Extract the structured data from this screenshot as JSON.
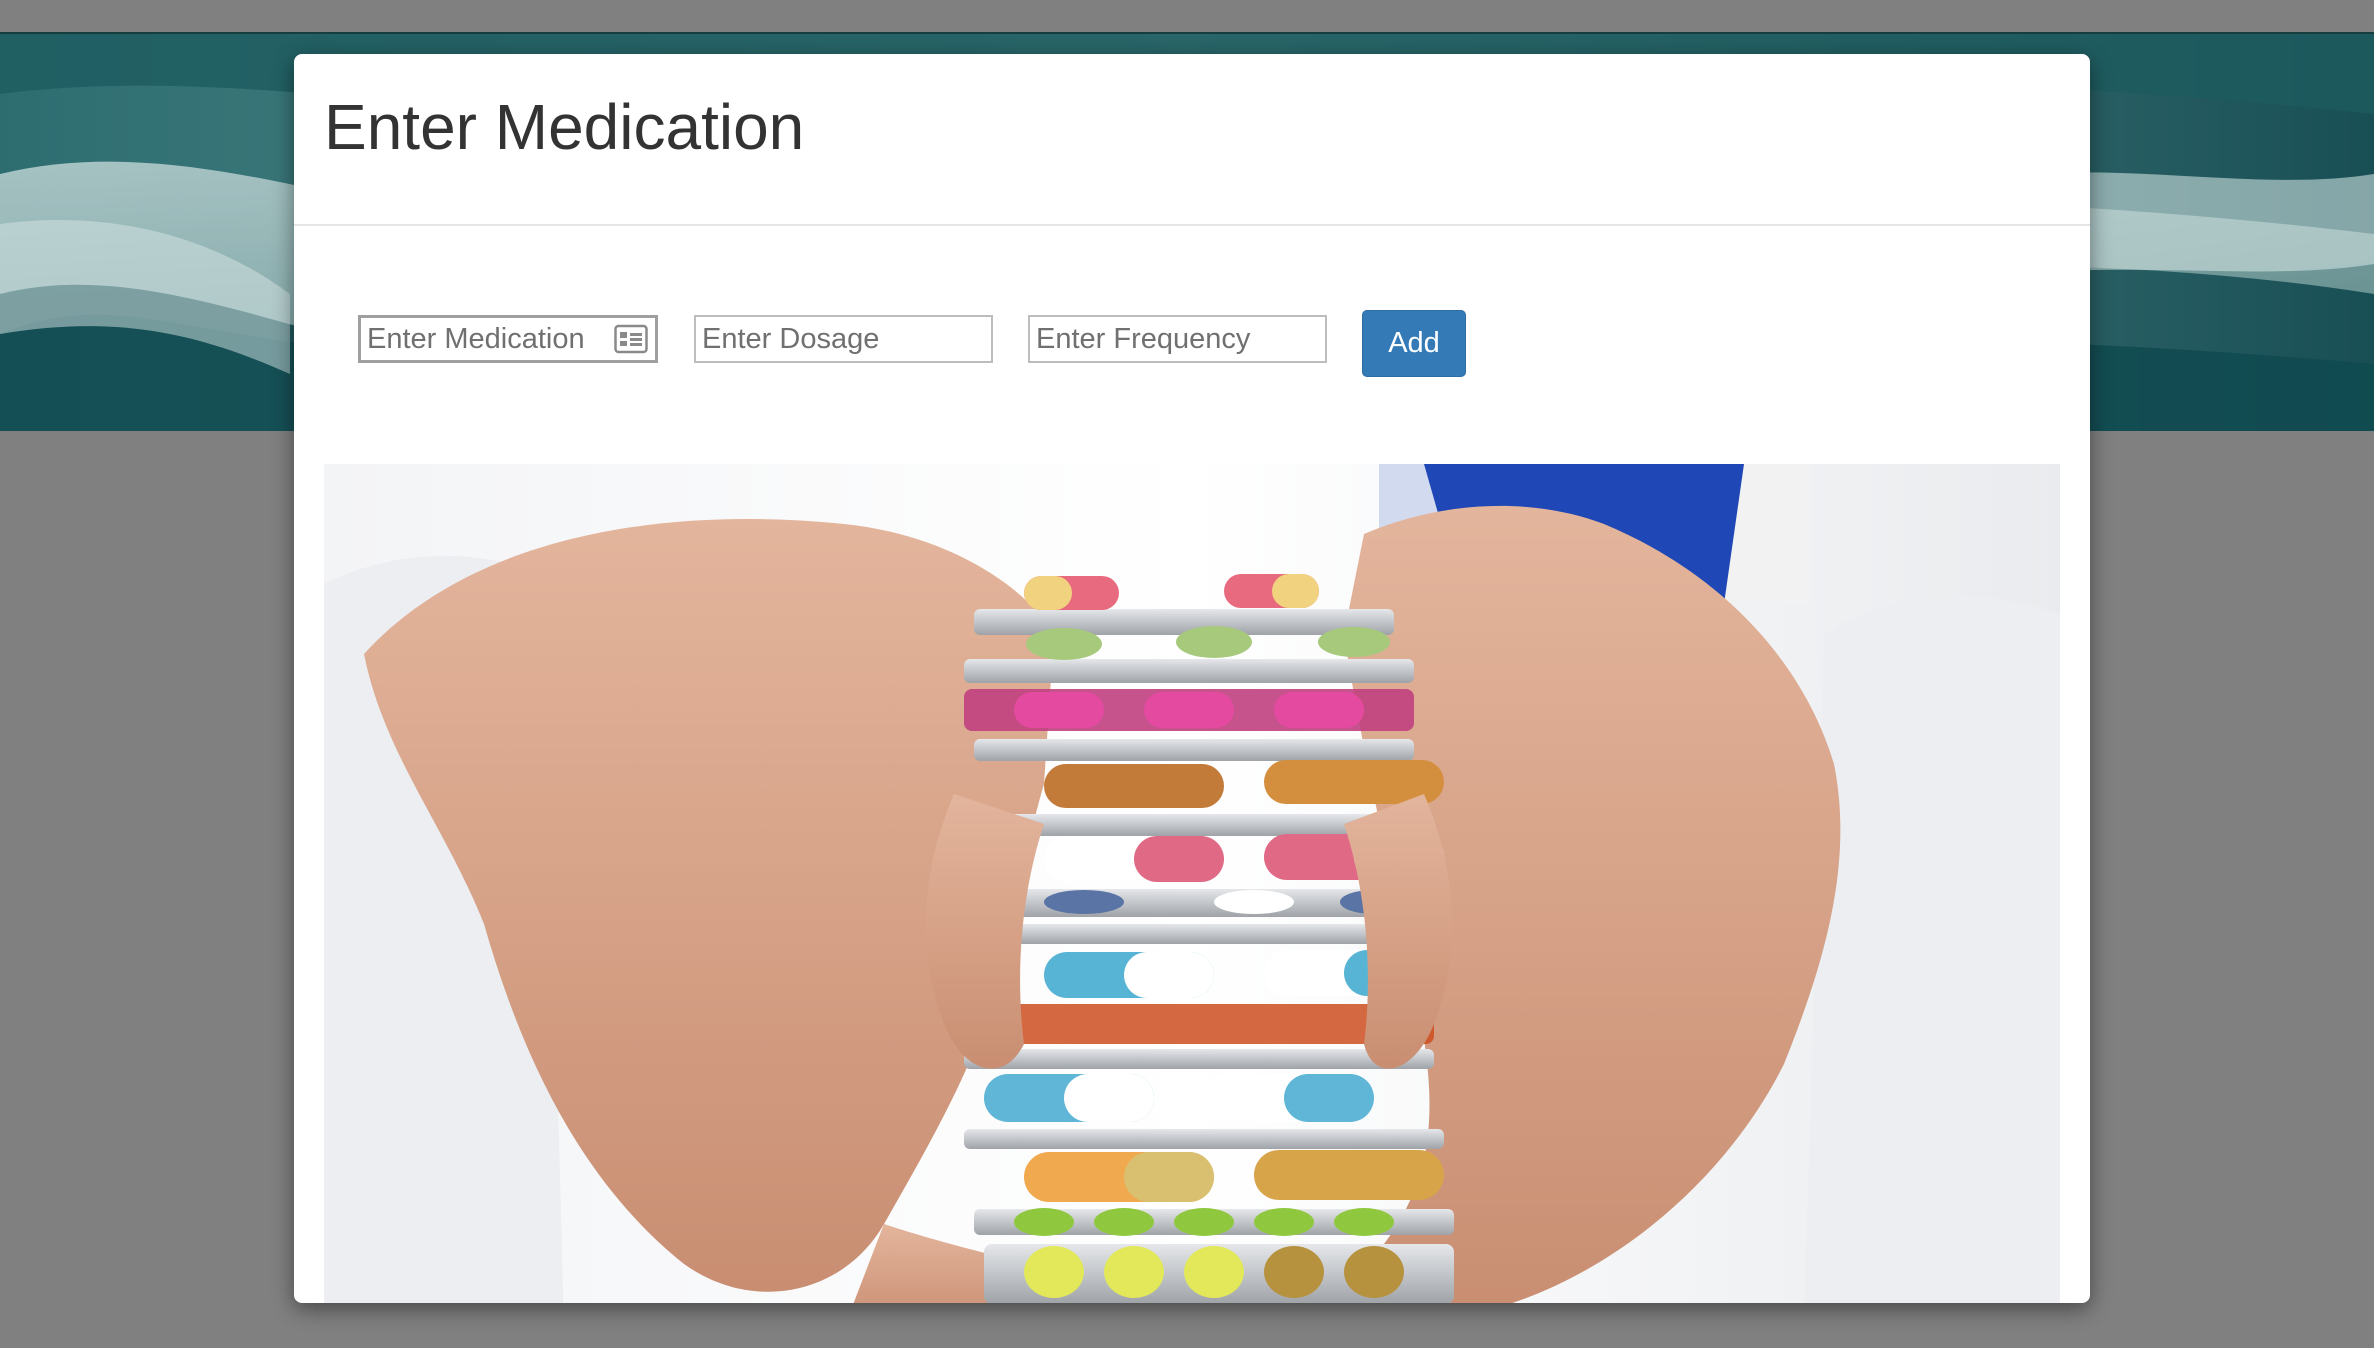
{
  "modal": {
    "title": "Enter Medication"
  },
  "form": {
    "medication_placeholder": "Enter Medication",
    "dosage_placeholder": "Enter Dosage",
    "frequency_placeholder": "Enter Frequency",
    "add_label": "Add"
  },
  "icons": {
    "medication_field_icon": "contact-card-icon"
  },
  "colors": {
    "primary_button": "#337ab7",
    "banner_teal": "#0e4f54",
    "page_overlay": "#808080"
  }
}
